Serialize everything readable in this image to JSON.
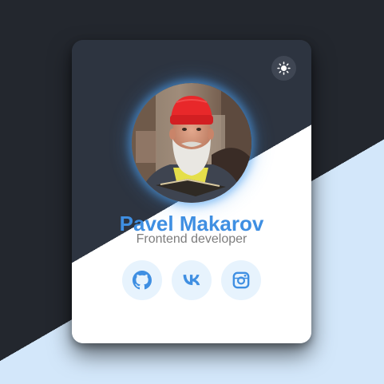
{
  "profile": {
    "name": "Pavel Makarov",
    "role": "Frontend developer",
    "avatar_alt": "Pavel Makarov"
  },
  "theme_toggle": {
    "icon": "sun-icon"
  },
  "socials": [
    {
      "icon": "github-icon",
      "label": "GitHub"
    },
    {
      "icon": "vk-icon",
      "label": "VK"
    },
    {
      "icon": "instagram-icon",
      "label": "Instagram"
    }
  ],
  "colors": {
    "accent": "#3f8fe2",
    "card_dark": "#2d3440",
    "page_dark": "#23272e",
    "page_light": "#d3e7fa",
    "social_bg": "#e7f3fd",
    "role_text": "#7d7d7d"
  }
}
